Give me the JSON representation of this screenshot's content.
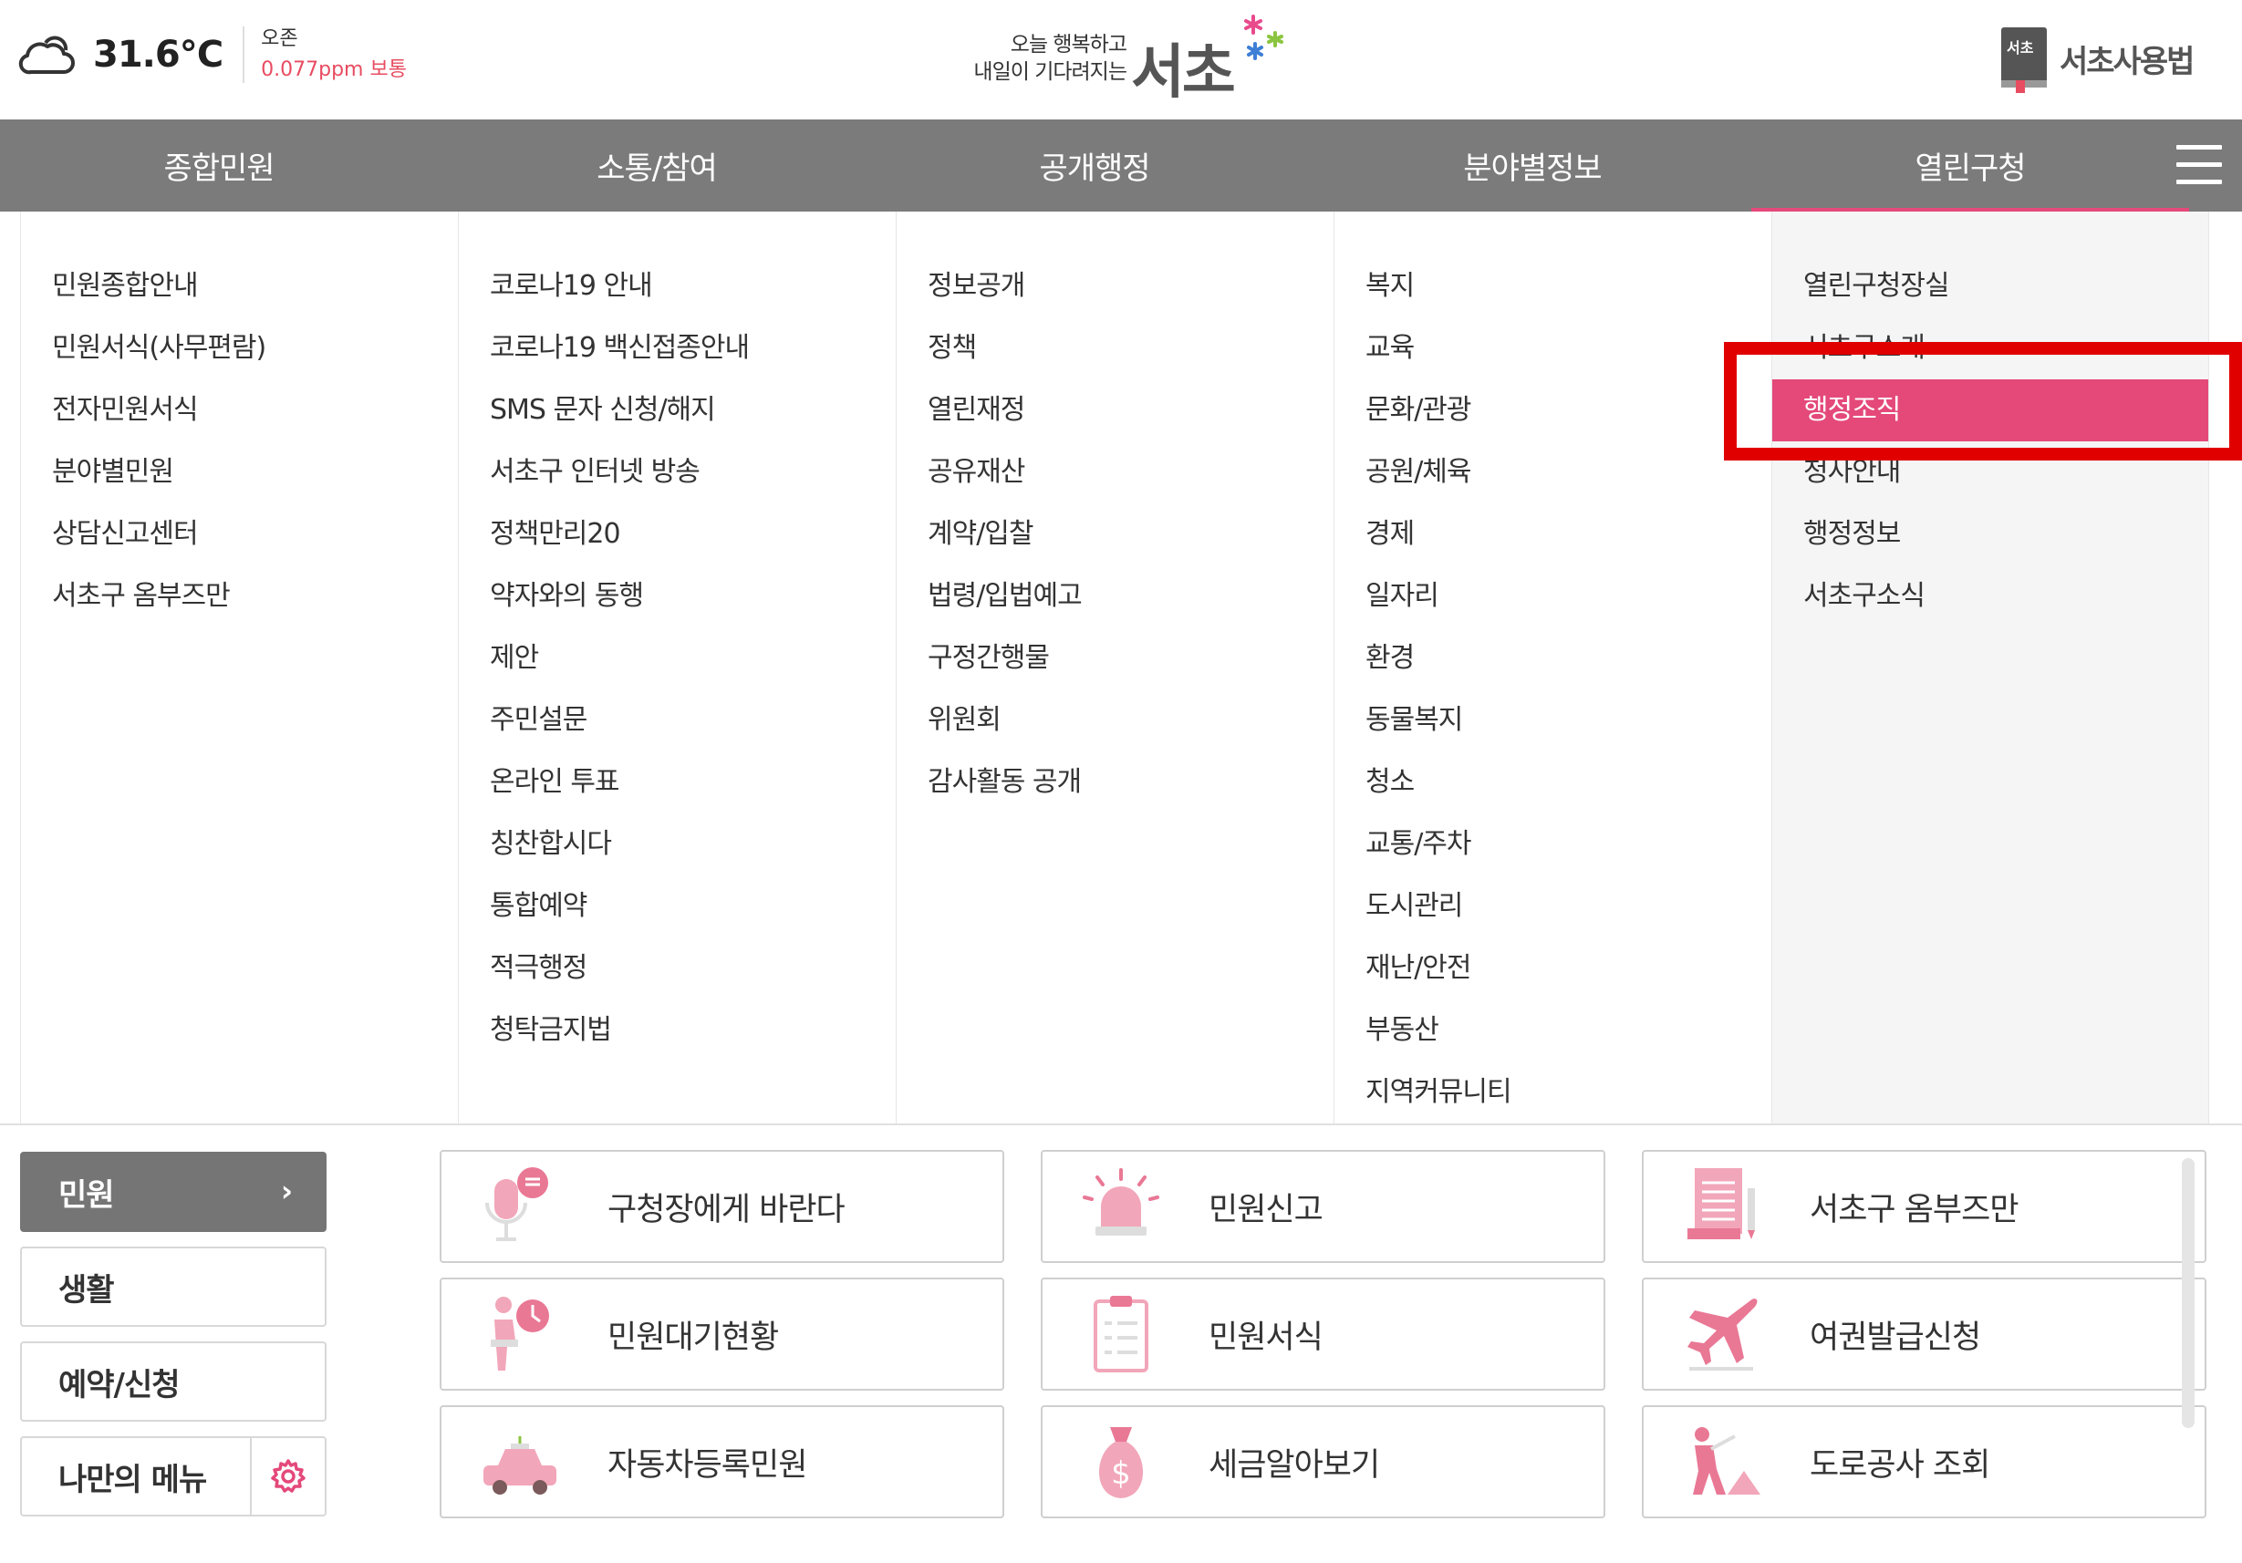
{
  "weather": {
    "temperature": "31.6℃",
    "air_label": "오존",
    "air_value": "0.077ppm 보통"
  },
  "logo": {
    "slogan_line1": "오늘 행복하고",
    "slogan_line2": "내일이 기다려지는",
    "name": "서초"
  },
  "dictionary": {
    "label": "서초사용법",
    "icon_text": "서초"
  },
  "nav": {
    "items": [
      "종합민원",
      "소통/참여",
      "공개행정",
      "분야별정보",
      "열린구청"
    ],
    "active_index": 4
  },
  "mega_menu": {
    "columns": [
      {
        "items": [
          "민원종합안내",
          "민원서식(사무편람)",
          "전자민원서식",
          "분야별민원",
          "상담신고센터",
          "서초구 옴부즈만"
        ]
      },
      {
        "items": [
          "코로나19 안내",
          "코로나19 백신접종안내",
          "SMS 문자 신청/해지",
          "서초구 인터넷 방송",
          "정책만리20",
          "약자와의 동행",
          "제안",
          "주민설문",
          "온라인 투표",
          "칭찬합시다",
          "통합예약",
          "적극행정",
          "청탁금지법"
        ]
      },
      {
        "items": [
          "정보공개",
          "정책",
          "열린재정",
          "공유재산",
          "계약/입찰",
          "법령/입법예고",
          "구정간행물",
          "위원회",
          "감사활동 공개"
        ]
      },
      {
        "items": [
          "복지",
          "교육",
          "문화/관광",
          "공원/체육",
          "경제",
          "일자리",
          "환경",
          "동물복지",
          "청소",
          "교통/주차",
          "도시관리",
          "재난/안전",
          "부동산",
          "지역커뮤니티"
        ]
      },
      {
        "items": [
          "열린구청장실",
          "서초구소개",
          "행정조직",
          "청사안내",
          "행정정보",
          "서초구소식"
        ]
      }
    ],
    "selected": "행정조직"
  },
  "side_tabs": {
    "complaint": "민원",
    "life": "생활",
    "reservation": "예약/신청",
    "my_menu": "나만의 메뉴"
  },
  "quick_menu": {
    "rows": [
      [
        "구청장에게 바란다",
        "민원신고",
        "서초구 옴부즈만"
      ],
      [
        "민원대기현황",
        "민원서식",
        "여권발급신청"
      ],
      [
        "자동차등록민원",
        "세금알아보기",
        "도로공사 조회"
      ]
    ],
    "icons": [
      [
        "microphone-chat-icon",
        "siren-icon",
        "document-pencil-icon"
      ],
      [
        "person-clock-icon",
        "clipboard-icon",
        "airplane-icon"
      ],
      [
        "car-icon",
        "money-bag-icon",
        "road-worker-icon"
      ]
    ]
  },
  "colors": {
    "accent": "#e4497a",
    "nav_bg": "#7b7b7b",
    "icon_pink": "#f2a6b9",
    "highlight": "#e00000"
  }
}
